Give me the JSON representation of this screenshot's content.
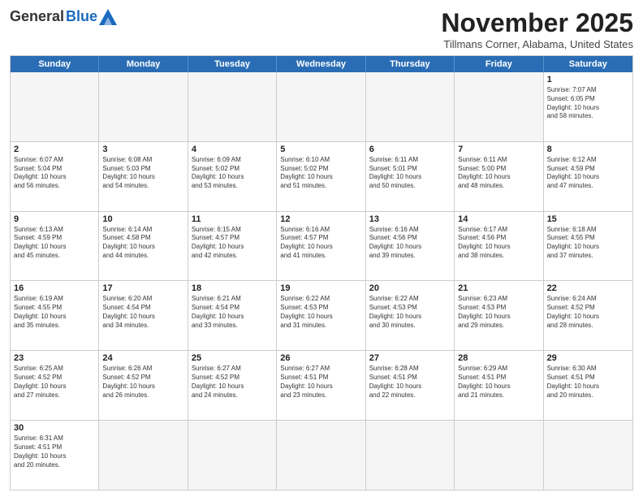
{
  "logo": {
    "general": "General",
    "blue": "Blue"
  },
  "header": {
    "month": "November 2025",
    "location": "Tillmans Corner, Alabama, United States"
  },
  "weekdays": [
    "Sunday",
    "Monday",
    "Tuesday",
    "Wednesday",
    "Thursday",
    "Friday",
    "Saturday"
  ],
  "rows": [
    [
      {
        "day": "",
        "info": "",
        "empty": true
      },
      {
        "day": "",
        "info": "",
        "empty": true
      },
      {
        "day": "",
        "info": "",
        "empty": true
      },
      {
        "day": "",
        "info": "",
        "empty": true
      },
      {
        "day": "",
        "info": "",
        "empty": true
      },
      {
        "day": "",
        "info": "",
        "empty": true
      },
      {
        "day": "1",
        "info": "Sunrise: 7:07 AM\nSunset: 6:05 PM\nDaylight: 10 hours\nand 58 minutes.",
        "empty": false
      }
    ],
    [
      {
        "day": "2",
        "info": "Sunrise: 6:07 AM\nSunset: 5:04 PM\nDaylight: 10 hours\nand 56 minutes.",
        "empty": false
      },
      {
        "day": "3",
        "info": "Sunrise: 6:08 AM\nSunset: 5:03 PM\nDaylight: 10 hours\nand 54 minutes.",
        "empty": false
      },
      {
        "day": "4",
        "info": "Sunrise: 6:09 AM\nSunset: 5:02 PM\nDaylight: 10 hours\nand 53 minutes.",
        "empty": false
      },
      {
        "day": "5",
        "info": "Sunrise: 6:10 AM\nSunset: 5:02 PM\nDaylight: 10 hours\nand 51 minutes.",
        "empty": false
      },
      {
        "day": "6",
        "info": "Sunrise: 6:11 AM\nSunset: 5:01 PM\nDaylight: 10 hours\nand 50 minutes.",
        "empty": false
      },
      {
        "day": "7",
        "info": "Sunrise: 6:11 AM\nSunset: 5:00 PM\nDaylight: 10 hours\nand 48 minutes.",
        "empty": false
      },
      {
        "day": "8",
        "info": "Sunrise: 6:12 AM\nSunset: 4:59 PM\nDaylight: 10 hours\nand 47 minutes.",
        "empty": false
      }
    ],
    [
      {
        "day": "9",
        "info": "Sunrise: 6:13 AM\nSunset: 4:59 PM\nDaylight: 10 hours\nand 45 minutes.",
        "empty": false
      },
      {
        "day": "10",
        "info": "Sunrise: 6:14 AM\nSunset: 4:58 PM\nDaylight: 10 hours\nand 44 minutes.",
        "empty": false
      },
      {
        "day": "11",
        "info": "Sunrise: 6:15 AM\nSunset: 4:57 PM\nDaylight: 10 hours\nand 42 minutes.",
        "empty": false
      },
      {
        "day": "12",
        "info": "Sunrise: 6:16 AM\nSunset: 4:57 PM\nDaylight: 10 hours\nand 41 minutes.",
        "empty": false
      },
      {
        "day": "13",
        "info": "Sunrise: 6:16 AM\nSunset: 4:56 PM\nDaylight: 10 hours\nand 39 minutes.",
        "empty": false
      },
      {
        "day": "14",
        "info": "Sunrise: 6:17 AM\nSunset: 4:56 PM\nDaylight: 10 hours\nand 38 minutes.",
        "empty": false
      },
      {
        "day": "15",
        "info": "Sunrise: 6:18 AM\nSunset: 4:55 PM\nDaylight: 10 hours\nand 37 minutes.",
        "empty": false
      }
    ],
    [
      {
        "day": "16",
        "info": "Sunrise: 6:19 AM\nSunset: 4:55 PM\nDaylight: 10 hours\nand 35 minutes.",
        "empty": false
      },
      {
        "day": "17",
        "info": "Sunrise: 6:20 AM\nSunset: 4:54 PM\nDaylight: 10 hours\nand 34 minutes.",
        "empty": false
      },
      {
        "day": "18",
        "info": "Sunrise: 6:21 AM\nSunset: 4:54 PM\nDaylight: 10 hours\nand 33 minutes.",
        "empty": false
      },
      {
        "day": "19",
        "info": "Sunrise: 6:22 AM\nSunset: 4:53 PM\nDaylight: 10 hours\nand 31 minutes.",
        "empty": false
      },
      {
        "day": "20",
        "info": "Sunrise: 6:22 AM\nSunset: 4:53 PM\nDaylight: 10 hours\nand 30 minutes.",
        "empty": false
      },
      {
        "day": "21",
        "info": "Sunrise: 6:23 AM\nSunset: 4:53 PM\nDaylight: 10 hours\nand 29 minutes.",
        "empty": false
      },
      {
        "day": "22",
        "info": "Sunrise: 6:24 AM\nSunset: 4:52 PM\nDaylight: 10 hours\nand 28 minutes.",
        "empty": false
      }
    ],
    [
      {
        "day": "23",
        "info": "Sunrise: 6:25 AM\nSunset: 4:52 PM\nDaylight: 10 hours\nand 27 minutes.",
        "empty": false
      },
      {
        "day": "24",
        "info": "Sunrise: 6:26 AM\nSunset: 4:52 PM\nDaylight: 10 hours\nand 26 minutes.",
        "empty": false
      },
      {
        "day": "25",
        "info": "Sunrise: 6:27 AM\nSunset: 4:52 PM\nDaylight: 10 hours\nand 24 minutes.",
        "empty": false
      },
      {
        "day": "26",
        "info": "Sunrise: 6:27 AM\nSunset: 4:51 PM\nDaylight: 10 hours\nand 23 minutes.",
        "empty": false
      },
      {
        "day": "27",
        "info": "Sunrise: 6:28 AM\nSunset: 4:51 PM\nDaylight: 10 hours\nand 22 minutes.",
        "empty": false
      },
      {
        "day": "28",
        "info": "Sunrise: 6:29 AM\nSunset: 4:51 PM\nDaylight: 10 hours\nand 21 minutes.",
        "empty": false
      },
      {
        "day": "29",
        "info": "Sunrise: 6:30 AM\nSunset: 4:51 PM\nDaylight: 10 hours\nand 20 minutes.",
        "empty": false
      }
    ],
    [
      {
        "day": "30",
        "info": "Sunrise: 6:31 AM\nSunset: 4:51 PM\nDaylight: 10 hours\nand 20 minutes.",
        "empty": false
      },
      {
        "day": "",
        "info": "",
        "empty": true
      },
      {
        "day": "",
        "info": "",
        "empty": true
      },
      {
        "day": "",
        "info": "",
        "empty": true
      },
      {
        "day": "",
        "info": "",
        "empty": true
      },
      {
        "day": "",
        "info": "",
        "empty": true
      },
      {
        "day": "",
        "info": "",
        "empty": true
      }
    ]
  ]
}
